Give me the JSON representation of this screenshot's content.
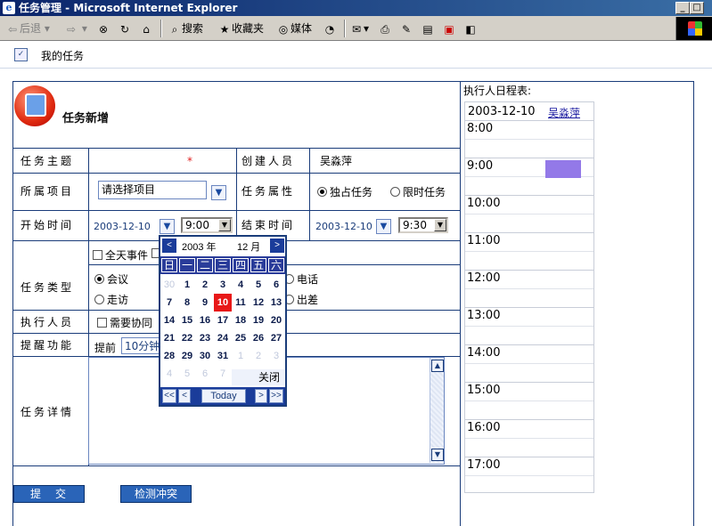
{
  "window": {
    "title": "任务管理 - Microsoft Internet Explorer",
    "min_label": "_",
    "max_label": "□",
    "close_label": "×"
  },
  "toolbar": {
    "back": "后退",
    "search": "搜索",
    "favorites": "收藏夹",
    "media": "媒体"
  },
  "breadcrumb": {
    "label": "我的任务"
  },
  "form": {
    "title": "任务新增",
    "subject": {
      "label": "任务主题",
      "required_mark": "*"
    },
    "creator": {
      "label": "创建人员",
      "value": "吴淼萍"
    },
    "project": {
      "label": "所属项目",
      "value": "请选择项目"
    },
    "attr": {
      "label": "任务属性",
      "option1": "独占任务",
      "option2": "限时任务",
      "selected": "独占任务"
    },
    "start": {
      "label": "开始时间",
      "date": "2003-12-10",
      "time": "9:00"
    },
    "end": {
      "label": "结束时间",
      "date": "2003-12-10",
      "time": "9:30"
    },
    "allday": {
      "label": "全天事件"
    },
    "type": {
      "label": "任务类型",
      "options": [
        "会议",
        "电话",
        "走访",
        "出差"
      ],
      "selected": "会议"
    },
    "executor": {
      "label": "执行人员",
      "collab": "需要协同"
    },
    "remind": {
      "label": "提醒功能",
      "prefix": "提前",
      "value": "10分钟"
    },
    "detail": {
      "label": "任务详情"
    },
    "submit": "提　交",
    "check_conflict": "检测冲突"
  },
  "schedule": {
    "title": "执行人日程表:",
    "date": "2003-12-10",
    "user": "吴淼萍",
    "slots": [
      "8:00",
      "9:00",
      "10:00",
      "11:00",
      "12:00",
      "13:00",
      "14:00",
      "15:00",
      "16:00",
      "17:00"
    ],
    "busy_slot": "9:00",
    "busy_color": "#9379e8"
  },
  "calendar": {
    "prev": "<",
    "next": ">",
    "year": "2003 年",
    "month": "12 月",
    "weekdays": [
      "日",
      "一",
      "二",
      "三",
      "四",
      "五",
      "六"
    ],
    "days": [
      [
        "30",
        "1",
        "2",
        "3",
        "4",
        "5",
        "6"
      ],
      [
        "7",
        "8",
        "9",
        "10",
        "11",
        "12",
        "13"
      ],
      [
        "14",
        "15",
        "16",
        "17",
        "18",
        "19",
        "20"
      ],
      [
        "21",
        "22",
        "23",
        "24",
        "25",
        "26",
        "27"
      ],
      [
        "28",
        "29",
        "30",
        "31",
        "1",
        "2",
        "3"
      ],
      [
        "4",
        "5",
        "6",
        "7",
        "",
        "",
        ""
      ]
    ],
    "selected_day": "10",
    "close": "关闭",
    "today": "Today",
    "nav": {
      "prev_year": "<<",
      "prev_month": "<",
      "next_month": ">",
      "next_year": ">>"
    }
  }
}
